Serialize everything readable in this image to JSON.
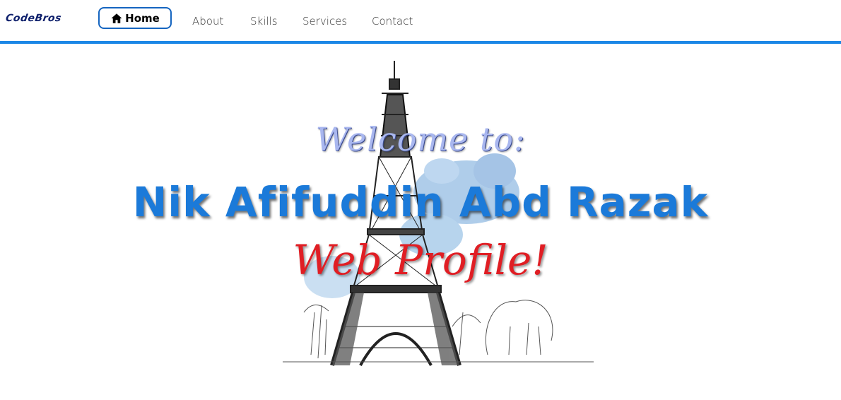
{
  "nav": {
    "brand": "CodeBros",
    "home_icon": "home-icon",
    "home_label": "Home",
    "links": [
      "About",
      "Skills",
      "Services",
      "Contact"
    ]
  },
  "hero": {
    "welcome": "Welcome to:",
    "name": "Nik Afifuddin Abd Razak",
    "subtitle": "Web Profile!",
    "illustration": "eiffel-tower-sketch-illustration"
  },
  "colors": {
    "accent": "#1b87e6",
    "name": "#1b7ad9",
    "welcome": "#a9b7ef",
    "subtitle": "#e01e24"
  }
}
